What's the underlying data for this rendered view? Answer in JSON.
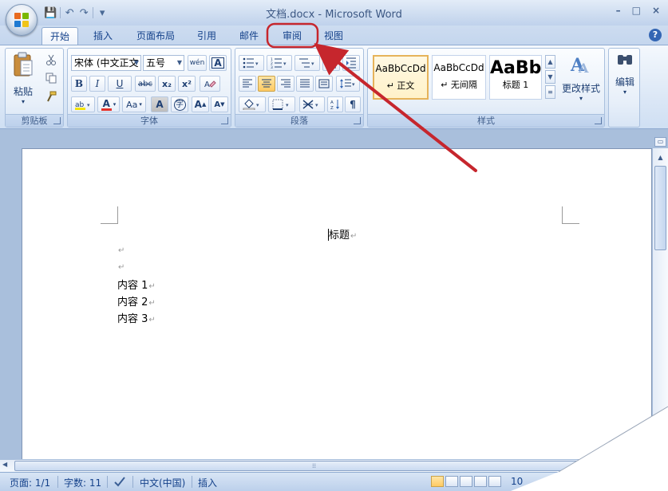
{
  "window": {
    "title": "文档.docx - Microsoft Word",
    "minimize": "–",
    "maximize": "□",
    "close": "×"
  },
  "qat": {
    "save": "💾",
    "undo": "↶",
    "redo": "↷",
    "customize": "▾"
  },
  "tabs": [
    {
      "label": "开始",
      "active": true
    },
    {
      "label": "插入"
    },
    {
      "label": "页面布局"
    },
    {
      "label": "引用"
    },
    {
      "label": "邮件"
    },
    {
      "label": "审阅"
    },
    {
      "label": "视图"
    }
  ],
  "help": "?",
  "groups": {
    "clipboard": {
      "label": "剪贴板",
      "paste": "粘贴"
    },
    "font": {
      "label": "字体",
      "font_name": "宋体 (中文正文",
      "font_size": "五号",
      "bold": "B",
      "italic": "I",
      "underline": "U",
      "strike": "abc",
      "subscript": "x₂",
      "superscript": "x²",
      "font_color": "A",
      "change_case": "Aa",
      "grow": "A",
      "shrink": "A",
      "char_shading": "A",
      "enclose": "字",
      "phonetic": "wén",
      "border": "A"
    },
    "paragraph": {
      "label": "段落"
    },
    "styles": {
      "label": "样式",
      "items": [
        {
          "sample": "AaBbCcDd",
          "name": "↵ 正文",
          "selected": true
        },
        {
          "sample": "AaBbCcDd",
          "name": "↵ 无间隔"
        },
        {
          "sample": "AaBb",
          "name": "标题 1"
        }
      ],
      "change_styles": "更改样式"
    },
    "editing": {
      "label": "编辑"
    }
  },
  "document": {
    "lines": [
      "标题",
      "",
      "",
      "内容 1",
      "内容 2",
      "内容 3"
    ],
    "para_mark": "↵"
  },
  "statusbar": {
    "page": "页面: 1/1",
    "words": "字数: 11",
    "language": "中文(中国)",
    "mode": "插入",
    "zoom": "10"
  },
  "colors": {
    "accent": "#15428b",
    "annotation": "#c6262d"
  }
}
